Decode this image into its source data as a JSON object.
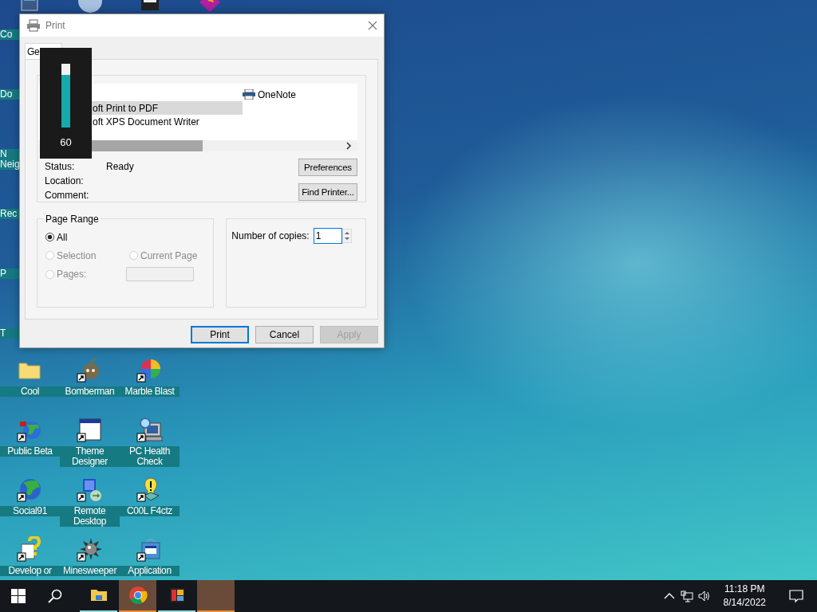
{
  "desktop": {
    "cut_labels": [
      {
        "lines": [
          "Co"
        ]
      },
      {
        "lines": [
          "Do"
        ]
      },
      {
        "lines": [
          "N",
          "Neig"
        ]
      },
      {
        "lines": [
          "Rec"
        ]
      },
      {
        "lines": [
          "P"
        ]
      },
      {
        "lines": [
          "T"
        ]
      }
    ],
    "icons": [
      {
        "label": "Cool"
      },
      {
        "label": "Bomberman"
      },
      {
        "label": "Marble Blast"
      },
      {
        "label": "Public Beta"
      },
      {
        "label": "Theme Designer"
      },
      {
        "label": "PC Health Check"
      },
      {
        "label": "Social91"
      },
      {
        "label": "Remote Desktop"
      },
      {
        "label": "C00L F4ctz"
      },
      {
        "label": "Develop or"
      },
      {
        "label": "Minesweeper"
      },
      {
        "label": "Application"
      }
    ]
  },
  "dialog": {
    "title": "Print",
    "tabs": [
      {
        "label": "Ge",
        "selected": true
      }
    ],
    "printers": [
      {
        "name": "oft Print to PDF",
        "selected": true
      },
      {
        "name": "oft XPS Document Writer",
        "selected": false
      },
      {
        "name": "OneNote",
        "selected": false
      }
    ],
    "info": [
      {
        "label": "Status:",
        "value": "Ready"
      },
      {
        "label": "Location:"
      },
      {
        "label": "Comment:"
      }
    ],
    "printer_buttons": [
      "Preferences",
      "Find Printer..."
    ],
    "page_range": {
      "title": "Page Range",
      "options": [
        {
          "label": "All",
          "selected": true,
          "disabled": false
        },
        {
          "label": "Selection",
          "selected": false,
          "disabled": true
        },
        {
          "label": "Current Page",
          "selected": false,
          "disabled": true
        },
        {
          "label": "Pages:",
          "selected": false,
          "disabled": true
        }
      ]
    },
    "copies": {
      "label": "Number of copies:",
      "value": "1"
    },
    "buttons": [
      {
        "label": "Print",
        "disabled": false
      },
      {
        "label": "Cancel",
        "disabled": false
      },
      {
        "label": "Apply",
        "disabled": true
      }
    ]
  },
  "level_popup": {
    "level": 0.83,
    "reading": "60"
  },
  "taskbar": {
    "apps": [
      {
        "running": true,
        "active": false
      },
      {
        "running": true,
        "active": true
      },
      {
        "running": true,
        "active": false
      },
      {
        "running": true,
        "active": true
      }
    ],
    "time": "11:18 PM",
    "date": "8/14/2022"
  }
}
